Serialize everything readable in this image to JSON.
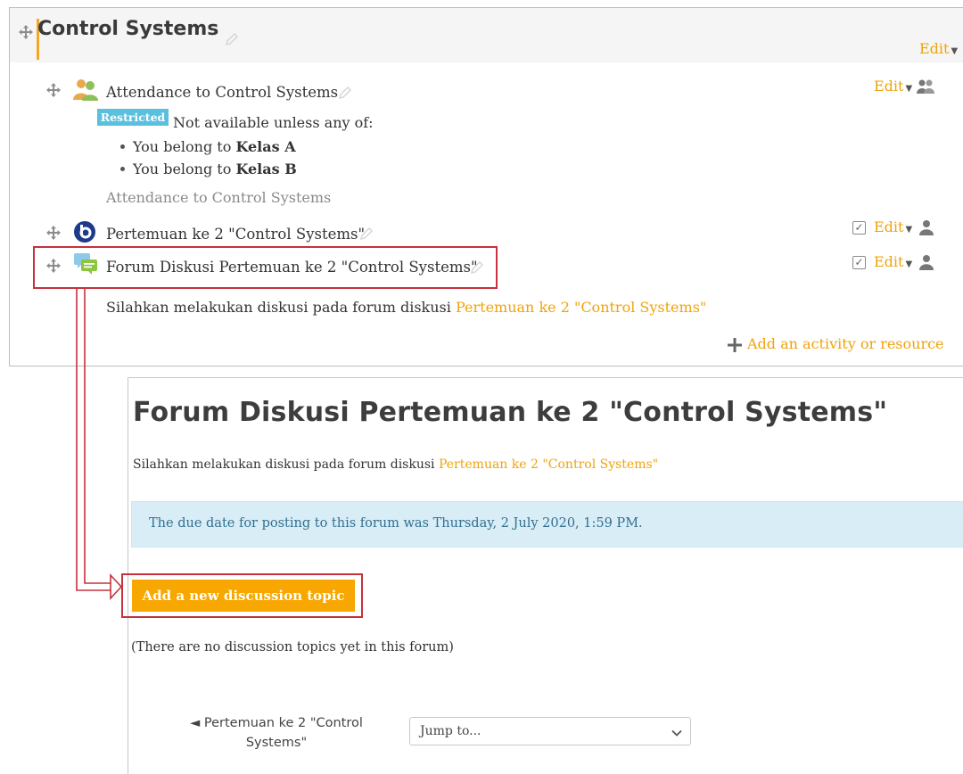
{
  "section": {
    "title": "Control Systems",
    "edit_label": "Edit"
  },
  "activities": [
    {
      "name": "Attendance to Control Systems",
      "edit_label": "Edit",
      "restricted_badge": "Restricted",
      "restriction_text": "Not available unless any of:",
      "conditions": [
        {
          "prefix": "You belong to ",
          "group": "Kelas A"
        },
        {
          "prefix": "You belong to ",
          "group": "Kelas B"
        }
      ],
      "description": "Attendance to Control Systems"
    },
    {
      "name": "Pertemuan ke 2 \"Control Systems\"",
      "edit_label": "Edit"
    },
    {
      "name": "Forum Diskusi Pertemuan ke 2 \"Control Systems\"",
      "edit_label": "Edit",
      "description_prefix": "Silahkan melakukan diskusi pada forum diskusi ",
      "description_link": "Pertemuan ke 2 \"Control Systems\""
    }
  ],
  "add_activity_label": "Add an activity or resource",
  "forum": {
    "title": "Forum Diskusi Pertemuan ke 2 \"Control Systems\"",
    "intro_prefix": "Silahkan melakukan diskusi pada forum diskusi ",
    "intro_link": "Pertemuan ke 2 \"Control Systems\"",
    "due_notice": "The due date for posting to this forum was Thursday, 2 July 2020, 1:59 PM.",
    "add_topic_button": "Add a new discussion topic",
    "empty_message": "(There are no discussion topics yet in this forum)",
    "prev_link": "◄ Pertemuan ke 2 \"Control Systems\"",
    "jump_to": "Jump to..."
  },
  "colors": {
    "accent": "#f0a30a",
    "button": "#f7a700",
    "alert_bg": "#d9edf7",
    "annotation_red": "#c5323b",
    "restricted_badge": "#5bc0de"
  }
}
